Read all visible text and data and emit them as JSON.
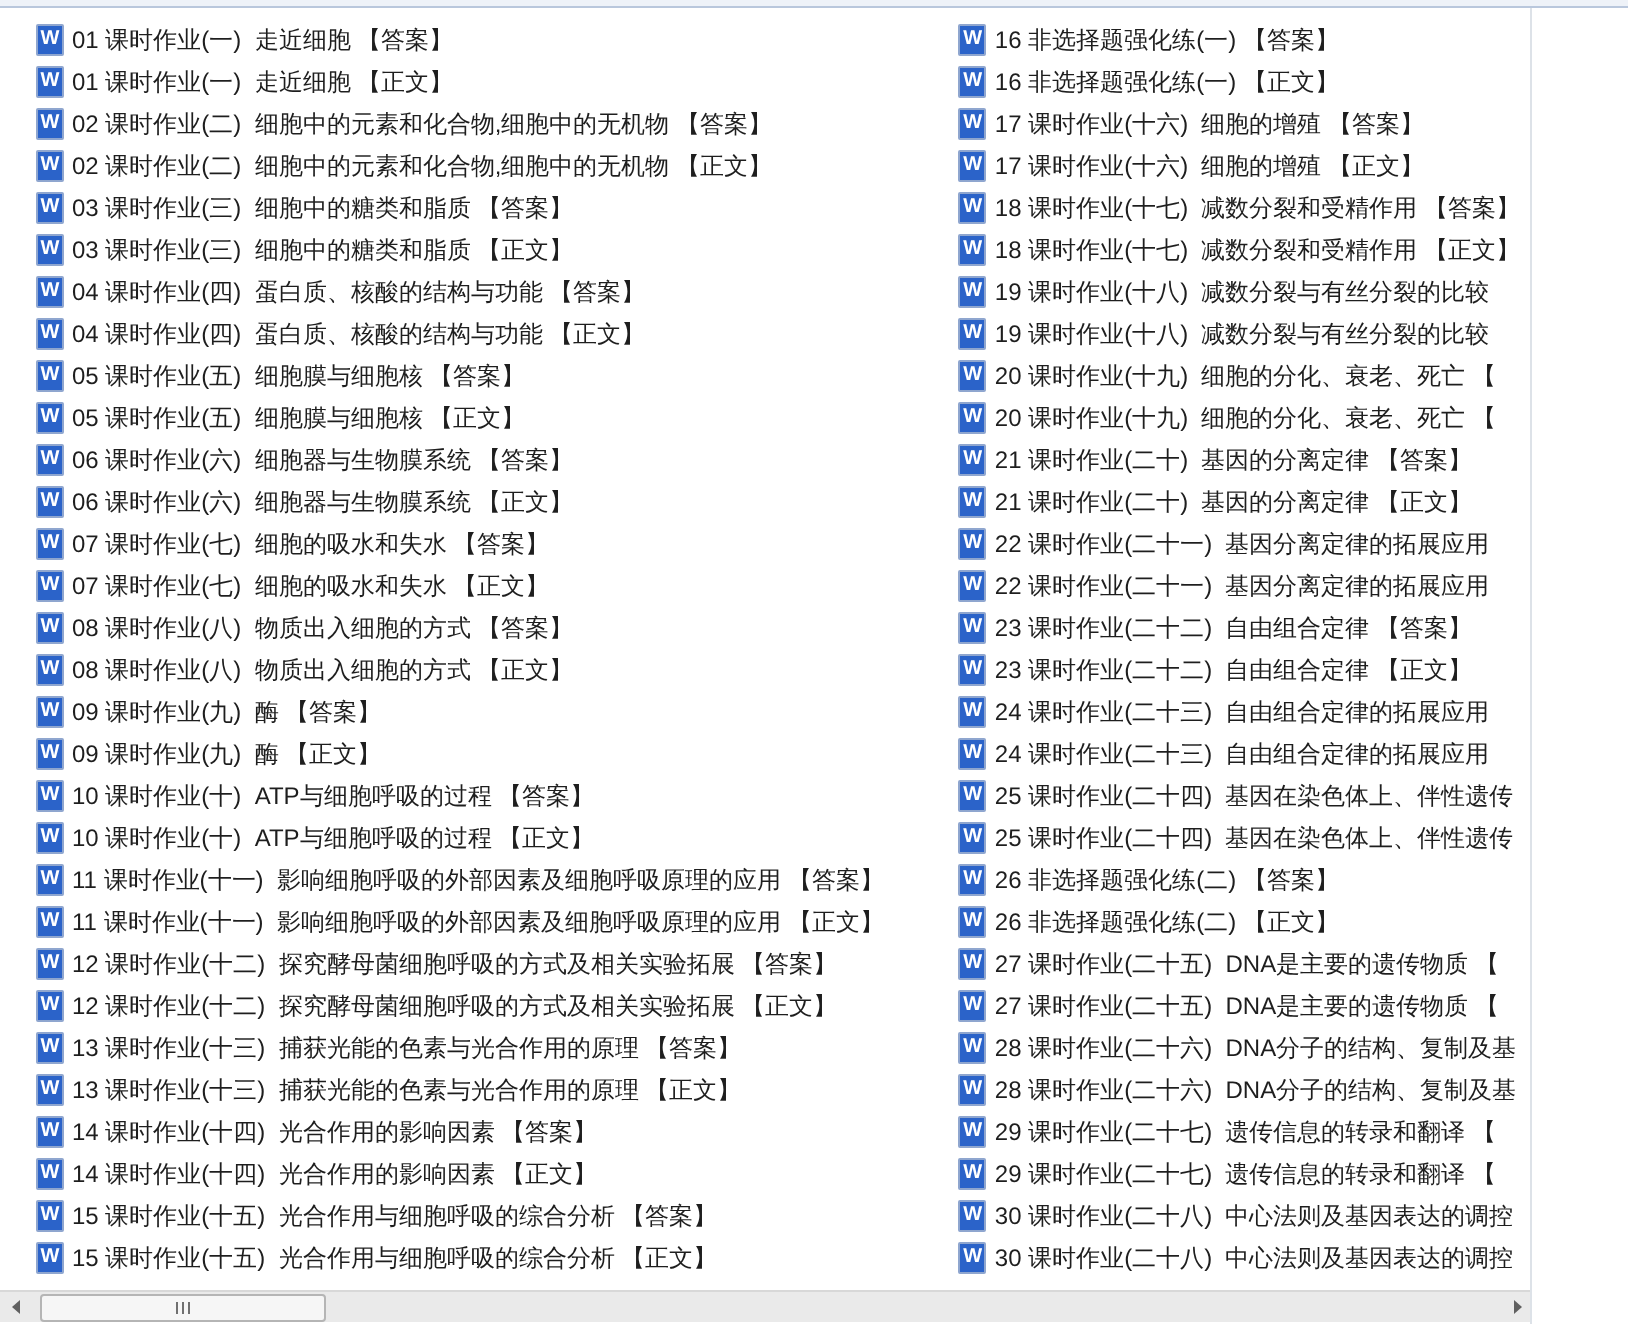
{
  "columns": [
    {
      "files": [
        {
          "icon_text": "W",
          "name": "01 课时作业(一)  走近细胞 【答案】"
        },
        {
          "icon_text": "W",
          "name": "01 课时作业(一)  走近细胞 【正文】"
        },
        {
          "icon_text": "W",
          "name": "02 课时作业(二)  细胞中的元素和化合物,细胞中的无机物 【答案】"
        },
        {
          "icon_text": "W",
          "name": "02 课时作业(二)  细胞中的元素和化合物,细胞中的无机物 【正文】"
        },
        {
          "icon_text": "W",
          "name": "03 课时作业(三)  细胞中的糖类和脂质 【答案】"
        },
        {
          "icon_text": "W",
          "name": "03 课时作业(三)  细胞中的糖类和脂质 【正文】"
        },
        {
          "icon_text": "W",
          "name": "04 课时作业(四)  蛋白质、核酸的结构与功能 【答案】"
        },
        {
          "icon_text": "W",
          "name": "04 课时作业(四)  蛋白质、核酸的结构与功能 【正文】"
        },
        {
          "icon_text": "W",
          "name": "05 课时作业(五)  细胞膜与细胞核 【答案】"
        },
        {
          "icon_text": "W",
          "name": "05 课时作业(五)  细胞膜与细胞核 【正文】"
        },
        {
          "icon_text": "W",
          "name": "06 课时作业(六)  细胞器与生物膜系统 【答案】"
        },
        {
          "icon_text": "W",
          "name": "06 课时作业(六)  细胞器与生物膜系统 【正文】"
        },
        {
          "icon_text": "W",
          "name": "07 课时作业(七)  细胞的吸水和失水 【答案】"
        },
        {
          "icon_text": "W",
          "name": "07 课时作业(七)  细胞的吸水和失水 【正文】"
        },
        {
          "icon_text": "W",
          "name": "08 课时作业(八)  物质出入细胞的方式 【答案】"
        },
        {
          "icon_text": "W",
          "name": "08 课时作业(八)  物质出入细胞的方式 【正文】"
        },
        {
          "icon_text": "W",
          "name": "09 课时作业(九)  酶 【答案】"
        },
        {
          "icon_text": "W",
          "name": "09 课时作业(九)  酶 【正文】"
        },
        {
          "icon_text": "W",
          "name": "10 课时作业(十)  ATP与细胞呼吸的过程 【答案】"
        },
        {
          "icon_text": "W",
          "name": "10 课时作业(十)  ATP与细胞呼吸的过程 【正文】"
        },
        {
          "icon_text": "W",
          "name": "11 课时作业(十一)  影响细胞呼吸的外部因素及细胞呼吸原理的应用 【答案】"
        },
        {
          "icon_text": "W",
          "name": "11 课时作业(十一)  影响细胞呼吸的外部因素及细胞呼吸原理的应用 【正文】"
        },
        {
          "icon_text": "W",
          "name": "12 课时作业(十二)  探究酵母菌细胞呼吸的方式及相关实验拓展 【答案】"
        },
        {
          "icon_text": "W",
          "name": "12 课时作业(十二)  探究酵母菌细胞呼吸的方式及相关实验拓展 【正文】"
        },
        {
          "icon_text": "W",
          "name": "13 课时作业(十三)  捕获光能的色素与光合作用的原理 【答案】"
        },
        {
          "icon_text": "W",
          "name": "13 课时作业(十三)  捕获光能的色素与光合作用的原理 【正文】"
        },
        {
          "icon_text": "W",
          "name": "14 课时作业(十四)  光合作用的影响因素 【答案】"
        },
        {
          "icon_text": "W",
          "name": "14 课时作业(十四)  光合作用的影响因素 【正文】"
        },
        {
          "icon_text": "W",
          "name": "15 课时作业(十五)  光合作用与细胞呼吸的综合分析 【答案】"
        },
        {
          "icon_text": "W",
          "name": "15 课时作业(十五)  光合作用与细胞呼吸的综合分析 【正文】"
        }
      ]
    },
    {
      "files": [
        {
          "icon_text": "W",
          "name": "16 非选择题强化练(一) 【答案】"
        },
        {
          "icon_text": "W",
          "name": "16 非选择题强化练(一) 【正文】"
        },
        {
          "icon_text": "W",
          "name": "17 课时作业(十六)  细胞的增殖 【答案】"
        },
        {
          "icon_text": "W",
          "name": "17 课时作业(十六)  细胞的增殖 【正文】"
        },
        {
          "icon_text": "W",
          "name": "18 课时作业(十七)  减数分裂和受精作用 【答案】"
        },
        {
          "icon_text": "W",
          "name": "18 课时作业(十七)  减数分裂和受精作用 【正文】"
        },
        {
          "icon_text": "W",
          "name": "19 课时作业(十八)  减数分裂与有丝分裂的比较"
        },
        {
          "icon_text": "W",
          "name": "19 课时作业(十八)  减数分裂与有丝分裂的比较"
        },
        {
          "icon_text": "W",
          "name": "20 课时作业(十九)  细胞的分化、衰老、死亡 【"
        },
        {
          "icon_text": "W",
          "name": "20 课时作业(十九)  细胞的分化、衰老、死亡 【"
        },
        {
          "icon_text": "W",
          "name": "21 课时作业(二十)  基因的分离定律 【答案】"
        },
        {
          "icon_text": "W",
          "name": "21 课时作业(二十)  基因的分离定律 【正文】"
        },
        {
          "icon_text": "W",
          "name": "22 课时作业(二十一)  基因分离定律的拓展应用"
        },
        {
          "icon_text": "W",
          "name": "22 课时作业(二十一)  基因分离定律的拓展应用"
        },
        {
          "icon_text": "W",
          "name": "23 课时作业(二十二)  自由组合定律 【答案】"
        },
        {
          "icon_text": "W",
          "name": "23 课时作业(二十二)  自由组合定律 【正文】"
        },
        {
          "icon_text": "W",
          "name": "24 课时作业(二十三)  自由组合定律的拓展应用"
        },
        {
          "icon_text": "W",
          "name": "24 课时作业(二十三)  自由组合定律的拓展应用"
        },
        {
          "icon_text": "W",
          "name": "25 课时作业(二十四)  基因在染色体上、伴性遗传"
        },
        {
          "icon_text": "W",
          "name": "25 课时作业(二十四)  基因在染色体上、伴性遗传"
        },
        {
          "icon_text": "W",
          "name": "26 非选择题强化练(二) 【答案】"
        },
        {
          "icon_text": "W",
          "name": "26 非选择题强化练(二) 【正文】"
        },
        {
          "icon_text": "W",
          "name": "27 课时作业(二十五)  DNA是主要的遗传物质 【"
        },
        {
          "icon_text": "W",
          "name": "27 课时作业(二十五)  DNA是主要的遗传物质 【"
        },
        {
          "icon_text": "W",
          "name": "28 课时作业(二十六)  DNA分子的结构、复制及基"
        },
        {
          "icon_text": "W",
          "name": "28 课时作业(二十六)  DNA分子的结构、复制及基"
        },
        {
          "icon_text": "W",
          "name": "29 课时作业(二十七)  遗传信息的转录和翻译 【"
        },
        {
          "icon_text": "W",
          "name": "29 课时作业(二十七)  遗传信息的转录和翻译 【"
        },
        {
          "icon_text": "W",
          "name": "30 课时作业(二十八)  中心法则及基因表达的调控"
        },
        {
          "icon_text": "W",
          "name": "30 课时作业(二十八)  中心法则及基因表达的调控"
        }
      ]
    }
  ]
}
